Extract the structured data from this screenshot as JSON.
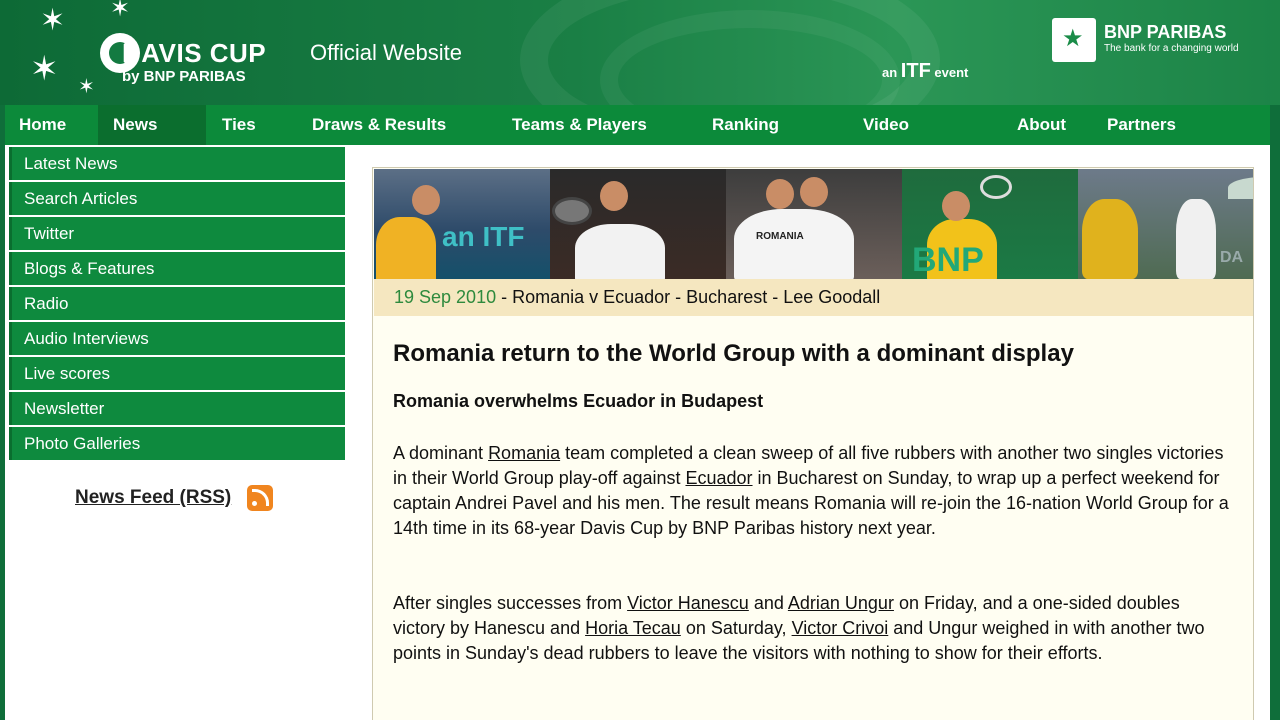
{
  "header": {
    "logo_title": "DAVIS CUP",
    "logo_sub": "by BNP PARIBAS",
    "site_label": "Official Website",
    "itf_prefix": "an",
    "itf_brand": "ITF",
    "itf_suffix": "event",
    "sponsor_name": "BNP PARIBAS",
    "sponsor_tagline": "The bank for a changing world"
  },
  "nav": {
    "items": [
      "Home",
      "News",
      "Ties",
      "Draws & Results",
      "Teams & Players",
      "Ranking",
      "Video",
      "About",
      "Partners"
    ],
    "active": "News"
  },
  "sidebar": {
    "items": [
      "Latest News",
      "Search Articles",
      "Twitter",
      "Blogs & Features",
      "Radio",
      "Audio Interviews",
      "Live scores",
      "Newsletter",
      "Photo Galleries"
    ],
    "rss_label": "News Feed (RSS)"
  },
  "article": {
    "photo_texts": [
      "an ITF",
      "ROMANIA",
      "BNP",
      "DA"
    ],
    "date": "19 Sep 2010",
    "dateline": " - Romania v Ecuador - Bucharest - Lee Goodall",
    "headline": "Romania return to the World Group with a dominant display",
    "subhead": "Romania overwhelms Ecuador in Budapest",
    "para1": [
      {
        "t": "A dominant "
      },
      {
        "t": "Romania",
        "link": true
      },
      {
        "t": " team completed a clean sweep of all five rubbers with another two singles victories in their World Group play-off against "
      },
      {
        "t": "Ecuador",
        "link": true
      },
      {
        "t": " in Bucharest on Sunday, to wrap up a perfect weekend for captain Andrei Pavel and his men. The result means Romania will re-join the 16-nation World Group for a 14th time in its 68-year Davis Cup by BNP Paribas history next year."
      }
    ],
    "para2": [
      {
        "t": "After singles successes from "
      },
      {
        "t": "Victor Hanescu",
        "link": true
      },
      {
        "t": " and "
      },
      {
        "t": "Adrian Ungur",
        "link": true
      },
      {
        "t": " on Friday, and a one-sided doubles victory by Hanescu and "
      },
      {
        "t": "Horia Tecau",
        "link": true
      },
      {
        "t": " on Saturday, "
      },
      {
        "t": "Victor Crivoi",
        "link": true
      },
      {
        "t": " and Ungur weighed in with another two points in Sunday's dead rubbers to leave the visitors with nothing to show for their efforts."
      }
    ]
  }
}
